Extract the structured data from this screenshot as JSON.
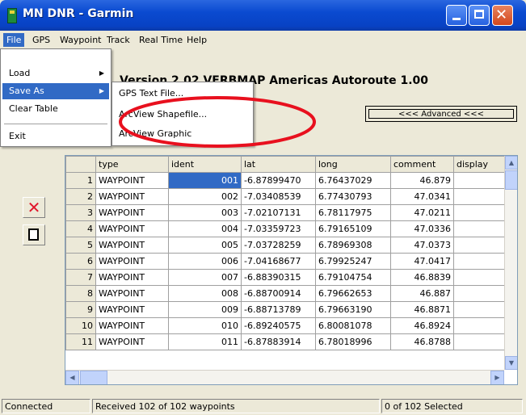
{
  "window": {
    "title": "MN DNR - Garmin",
    "icons": {
      "app": "garmin-app-icon",
      "minimize": "minimize-icon",
      "maximize": "maximize-icon",
      "close": "close-icon"
    }
  },
  "menubar": {
    "items": [
      "File",
      "GPS",
      "Waypoint",
      "Track",
      "Real Time",
      "Help"
    ]
  },
  "file_menu": {
    "load": "Load",
    "save_as": "Save As",
    "clear_table": "Clear Table",
    "exit": "Exit"
  },
  "save_as_submenu": {
    "gps_text": "GPS Text File...",
    "arcview_shapefile": "ArcView Shapefile...",
    "arcview_graphic": "ArcView Graphic"
  },
  "version_text": "Version 2.02 VERBMAP Americas Autoroute 1.00",
  "advanced_button": "<<< Advanced <<<",
  "side_buttons": {
    "delete_icon": "delete-x-icon",
    "clear_icon": "document-icon"
  },
  "table": {
    "headers": [
      "type",
      "ident",
      "lat",
      "long",
      "comment",
      "display"
    ],
    "rows": [
      {
        "n": "1",
        "type": "WAYPOINT",
        "ident": "001",
        "lat": "-6.87899470",
        "long": "6.76437029",
        "comment": "46.879",
        "display": ""
      },
      {
        "n": "2",
        "type": "WAYPOINT",
        "ident": "002",
        "lat": "-7.03408539",
        "long": "6.77430793",
        "comment": "47.0341",
        "display": ""
      },
      {
        "n": "3",
        "type": "WAYPOINT",
        "ident": "003",
        "lat": "-7.02107131",
        "long": "6.78117975",
        "comment": "47.0211",
        "display": ""
      },
      {
        "n": "4",
        "type": "WAYPOINT",
        "ident": "004",
        "lat": "-7.03359723",
        "long": "6.79165109",
        "comment": "47.0336",
        "display": ""
      },
      {
        "n": "5",
        "type": "WAYPOINT",
        "ident": "005",
        "lat": "-7.03728259",
        "long": "6.78969308",
        "comment": "47.0373",
        "display": ""
      },
      {
        "n": "6",
        "type": "WAYPOINT",
        "ident": "006",
        "lat": "-7.04168677",
        "long": "6.79925247",
        "comment": "47.0417",
        "display": ""
      },
      {
        "n": "7",
        "type": "WAYPOINT",
        "ident": "007",
        "lat": "-6.88390315",
        "long": "6.79104754",
        "comment": "46.8839",
        "display": ""
      },
      {
        "n": "8",
        "type": "WAYPOINT",
        "ident": "008",
        "lat": "-6.88700914",
        "long": "6.79662653",
        "comment": "46.887",
        "display": ""
      },
      {
        "n": "9",
        "type": "WAYPOINT",
        "ident": "009",
        "lat": "-6.88713789",
        "long": "6.79663190",
        "comment": "46.8871",
        "display": ""
      },
      {
        "n": "10",
        "type": "WAYPOINT",
        "ident": "010",
        "lat": "-6.89240575",
        "long": "6.80081078",
        "comment": "46.8924",
        "display": ""
      },
      {
        "n": "11",
        "type": "WAYPOINT",
        "ident": "011",
        "lat": "-6.87883914",
        "long": "6.78018996",
        "comment": "46.8788",
        "display": ""
      }
    ],
    "selected_cell": "row 1 ident"
  },
  "statusbar": {
    "connection": "Connected",
    "received": "Received 102 of 102 waypoints",
    "selected": "0 of 102 Selected"
  },
  "colors": {
    "titlebar": "#0a4ad0",
    "selection": "#316ac5",
    "annotation": "#e8101e",
    "delete_icon": "#e0162b"
  }
}
